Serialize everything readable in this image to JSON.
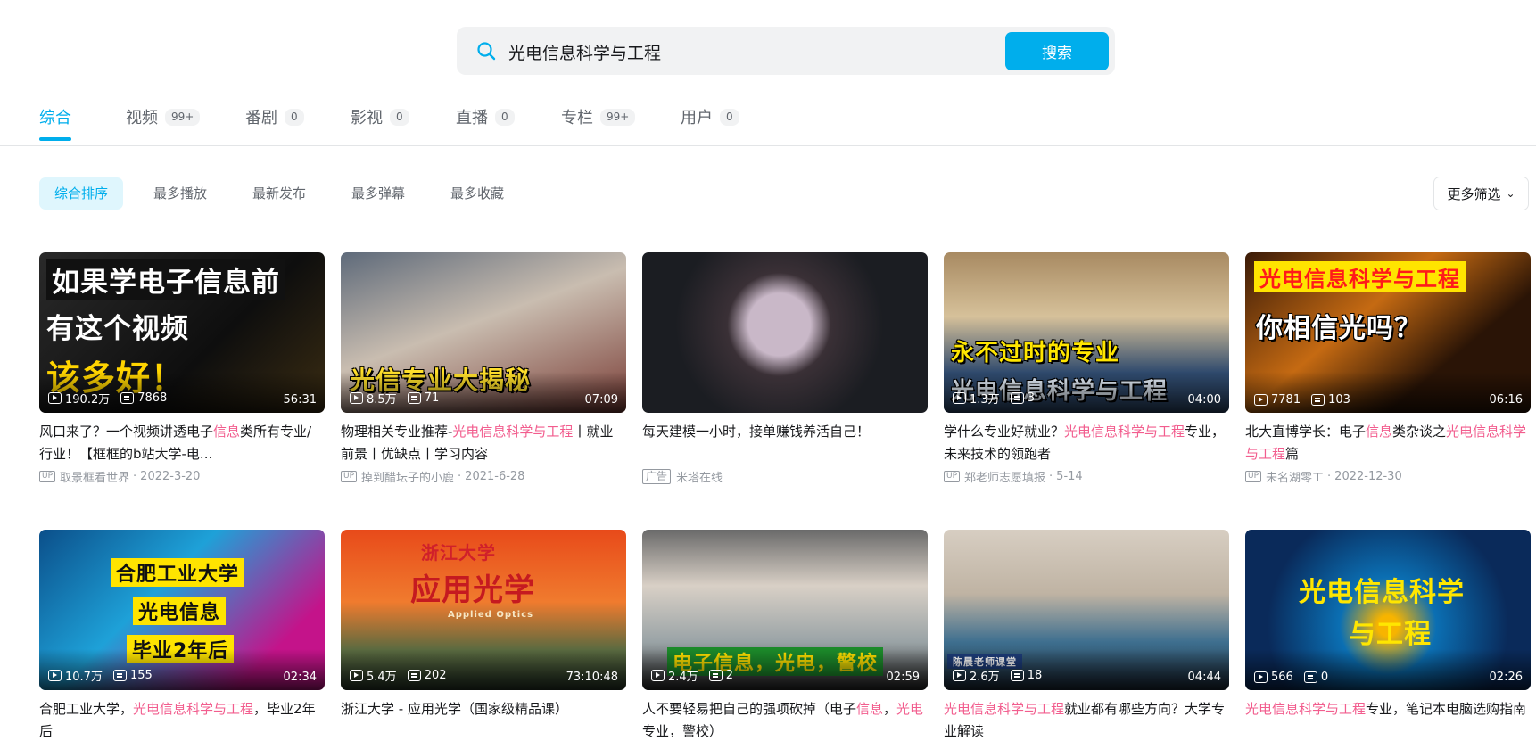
{
  "search": {
    "query": "光电信息科学与工程",
    "button_label": "搜索"
  },
  "tabs": [
    {
      "label": "综合",
      "count": ""
    },
    {
      "label": "视频",
      "count": "99+"
    },
    {
      "label": "番剧",
      "count": "0"
    },
    {
      "label": "影视",
      "count": "0"
    },
    {
      "label": "直播",
      "count": "0"
    },
    {
      "label": "专栏",
      "count": "99+"
    },
    {
      "label": "用户",
      "count": "0"
    }
  ],
  "sort_options": [
    "综合排序",
    "最多播放",
    "最新发布",
    "最多弹幕",
    "最多收藏"
  ],
  "more_filter": "更多筛选",
  "videos": [
    {
      "overlay": [
        "如果学电子信息前",
        "有这个视频",
        "该多好！"
      ],
      "views": "190.2万",
      "danmaku": "7868",
      "duration": "56:31",
      "title_parts": [
        [
          "风口来了？一个视频讲透电子",
          false
        ],
        [
          "信息",
          true
        ],
        [
          "类所有专业/行业！【框框的b站大学-电...",
          false
        ]
      ],
      "up_tag": "UP",
      "author": "取景框看世界",
      "date": "2022-3-20"
    },
    {
      "overlay": [
        "光信专业大揭秘"
      ],
      "views": "8.5万",
      "danmaku": "71",
      "duration": "07:09",
      "title_parts": [
        [
          "物理相关专业推荐-",
          false
        ],
        [
          "光电信息科学与工程",
          true
        ],
        [
          "丨就业前景丨优缺点丨学习内容",
          false
        ]
      ],
      "up_tag": "UP",
      "author": "掉到醋坛子的小鹿",
      "date": "2021-6-28"
    },
    {
      "overlay": [],
      "views": "",
      "danmaku": "",
      "duration": "",
      "title_parts": [
        [
          "每天建模一小时，接单赚钱养活自己！",
          false
        ]
      ],
      "up_tag": "",
      "ad_tag": "广告",
      "author": "米塔在线",
      "date": ""
    },
    {
      "overlay": [
        "永不过时的专业",
        "光电信息科学与工程"
      ],
      "views": "1.3万",
      "danmaku": "3",
      "duration": "04:00",
      "title_parts": [
        [
          "学什么专业好就业？",
          false
        ],
        [
          "光电信息科学与工程",
          true
        ],
        [
          "专业，未来技术的领跑者",
          false
        ]
      ],
      "up_tag": "UP",
      "author": "郑老师志愿填报",
      "date": "5-14"
    },
    {
      "overlay": [
        "光电信息科学与工程",
        "你相信光吗？"
      ],
      "views": "7781",
      "danmaku": "103",
      "duration": "06:16",
      "title_parts": [
        [
          "北大直博学长：电子",
          false
        ],
        [
          "信息",
          true
        ],
        [
          "类杂谈之",
          false
        ],
        [
          "光电信息科学与工程",
          true
        ],
        [
          "篇",
          false
        ]
      ],
      "up_tag": "UP",
      "author": "未名湖零工",
      "date": "2022-12-30"
    },
    {
      "overlay": [
        "合肥工业大学",
        "光电信息",
        "毕业2年后"
      ],
      "views": "10.7万",
      "danmaku": "155",
      "duration": "02:34",
      "title_parts": [
        [
          "合肥工业大学，",
          false
        ],
        [
          "光电信息科学与工程",
          true
        ],
        [
          "，毕业2年后",
          false
        ]
      ],
      "up_tag": "",
      "author": "",
      "date": ""
    },
    {
      "overlay": [
        "浙江大学",
        "应用光学",
        "Applied Optics"
      ],
      "views": "5.4万",
      "danmaku": "202",
      "duration": "73:10:48",
      "title_parts": [
        [
          "浙江大学 - 应用光学（国家级精品课）",
          false
        ]
      ],
      "up_tag": "",
      "author": "",
      "date": ""
    },
    {
      "overlay": [
        "电子信息，光电，警校"
      ],
      "views": "2.4万",
      "danmaku": "2",
      "duration": "02:59",
      "title_parts": [
        [
          "人不要轻易把自己的强项砍掉（电子",
          false
        ],
        [
          "信息",
          true
        ],
        [
          "，",
          false
        ],
        [
          "光电",
          true
        ],
        [
          "专业，警校）",
          false
        ]
      ],
      "up_tag": "",
      "author": "",
      "date": ""
    },
    {
      "overlay": [
        "陈晨老师课堂"
      ],
      "views": "2.6万",
      "danmaku": "18",
      "duration": "04:44",
      "title_parts": [
        [
          "光电信息科学与工程",
          true
        ],
        [
          "就业都有哪些方向？大学专业解读",
          false
        ]
      ],
      "up_tag": "",
      "author": "",
      "date": ""
    },
    {
      "overlay": [
        "光电信息科学",
        "与工程"
      ],
      "views": "566",
      "danmaku": "0",
      "duration": "02:26",
      "title_parts": [
        [
          "光电信息科学与工程",
          true
        ],
        [
          "专业，笔记本电脑选购指南",
          false
        ]
      ],
      "up_tag": "",
      "author": "",
      "date": ""
    }
  ],
  "colors": {
    "accent": "#00aeec",
    "highlight": "#f25d8e",
    "meta": "#9499a0"
  }
}
